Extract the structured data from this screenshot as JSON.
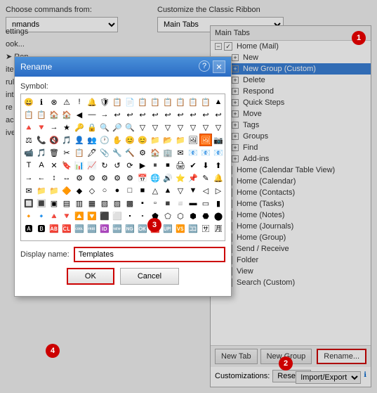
{
  "bg": {
    "commands_label": "Choose commands from:",
    "commands_value": "nmands",
    "customize_label": "Customize the Classic Ribbon",
    "tabs_value": "Main Tabs"
  },
  "left_settings": {
    "lines": [
      "ettings",
      "ook...",
      "Rep",
      "items",
      "rules",
      "ints",
      "re",
      "ach",
      "ive A"
    ]
  },
  "ribbon": {
    "title": "Main Tabs",
    "tree": [
      {
        "level": 0,
        "expand": true,
        "checked": true,
        "label": "Home (Mail)",
        "indent": 0
      },
      {
        "level": 1,
        "expand": false,
        "checked": false,
        "label": "New",
        "indent": 12,
        "highlighted": false
      },
      {
        "level": 1,
        "expand": false,
        "checked": false,
        "label": "New Group (Custom)",
        "indent": 12,
        "highlighted": true
      },
      {
        "level": 1,
        "expand": false,
        "checked": false,
        "label": "Delete",
        "indent": 12
      },
      {
        "level": 1,
        "expand": false,
        "checked": false,
        "label": "Respond",
        "indent": 12
      },
      {
        "level": 1,
        "expand": false,
        "checked": false,
        "label": "Quick Steps",
        "indent": 12
      },
      {
        "level": 1,
        "expand": false,
        "checked": false,
        "label": "Move",
        "indent": 12
      },
      {
        "level": 1,
        "expand": false,
        "checked": false,
        "label": "Tags",
        "indent": 12
      },
      {
        "level": 1,
        "expand": false,
        "checked": false,
        "label": "Groups",
        "indent": 12
      },
      {
        "level": 1,
        "expand": false,
        "checked": false,
        "label": "Find",
        "indent": 12
      },
      {
        "level": 1,
        "expand": false,
        "checked": false,
        "label": "Add-ins",
        "indent": 12
      },
      {
        "level": 0,
        "expand": false,
        "checked": false,
        "label": "Home (Calendar Table View)",
        "indent": 0
      },
      {
        "level": 0,
        "expand": false,
        "checked": false,
        "label": "Home (Calendar)",
        "indent": 0
      },
      {
        "level": 0,
        "expand": false,
        "checked": false,
        "label": "Home (Contacts)",
        "indent": 0
      },
      {
        "level": 0,
        "expand": false,
        "checked": false,
        "label": "Home (Tasks)",
        "indent": 0
      },
      {
        "level": 0,
        "expand": false,
        "checked": false,
        "label": "Home (Notes)",
        "indent": 0
      },
      {
        "level": 0,
        "expand": false,
        "checked": false,
        "label": "Home (Journals)",
        "indent": 0
      },
      {
        "level": 0,
        "expand": false,
        "checked": false,
        "label": "Home (Group)",
        "indent": 0
      },
      {
        "level": 0,
        "expand": false,
        "checked": false,
        "label": "Send / Receive",
        "indent": 0
      },
      {
        "level": 0,
        "expand": true,
        "checked": false,
        "label": "Folder",
        "indent": 0,
        "partial": true
      },
      {
        "level": 0,
        "expand": true,
        "checked": true,
        "label": "View",
        "indent": 0
      },
      {
        "level": 0,
        "expand": true,
        "checked": true,
        "label": "Search (Custom)",
        "indent": 0
      }
    ],
    "buttons": {
      "new_tab": "New Tab",
      "new_group": "New Group",
      "rename": "Rename..."
    },
    "customizations_label": "Customizations:",
    "reset_label": "Reset",
    "import_export_label": "Import/Export"
  },
  "dialog": {
    "title": "Rename",
    "help_label": "?",
    "close_label": "✕",
    "symbol_label": "Symbol:",
    "display_name_label": "Display name:",
    "display_name_value": "Templates",
    "ok_label": "OK",
    "cancel_label": "Cancel",
    "symbols": [
      "😀",
      "ℹ",
      "⊗",
      "❗",
      "⚠",
      "🔔",
      "🛡",
      "📋",
      "📄",
      "📄",
      "📋",
      "📋",
      "📋",
      "📋",
      "📋",
      "🏠",
      "🏠",
      "◀",
      "—",
      "→",
      "◁",
      "🔺",
      "🔻",
      "→",
      "★",
      "🔑",
      "🔒",
      "🔍",
      "🔎",
      "🔍",
      "▽",
      "🔻",
      "⚖",
      "📞",
      "🔇",
      "🎵",
      "👤",
      "👥",
      "🕐",
      "✋",
      "😊",
      "😊",
      "📁",
      "📂",
      "📁",
      "🖼",
      "🖼",
      "📷",
      "📹",
      "🎵",
      "🗑",
      "✂",
      "📋",
      "🖊",
      "📎",
      "🔧",
      "🔨",
      "⚙",
      "🏠",
      "🏢",
      "✉",
      "📧",
      "T",
      "A",
      "✕",
      "🔖",
      "📊",
      "📈",
      "↻",
      "↺",
      "⟳",
      "▶",
      "⏸",
      "⏹",
      "🖨",
      "✔",
      "⬇",
      "⬆",
      "→",
      "←",
      "↕",
      "↔",
      "⚙",
      "⚙",
      "📅",
      "🌐",
      "🔊",
      "⭐",
      "📌",
      "✎",
      "🔔",
      "✉",
      "📁"
    ],
    "selected_symbol_index": 62
  },
  "badges": {
    "b1": "1",
    "b2": "2",
    "b3": "3",
    "b4": "4"
  }
}
